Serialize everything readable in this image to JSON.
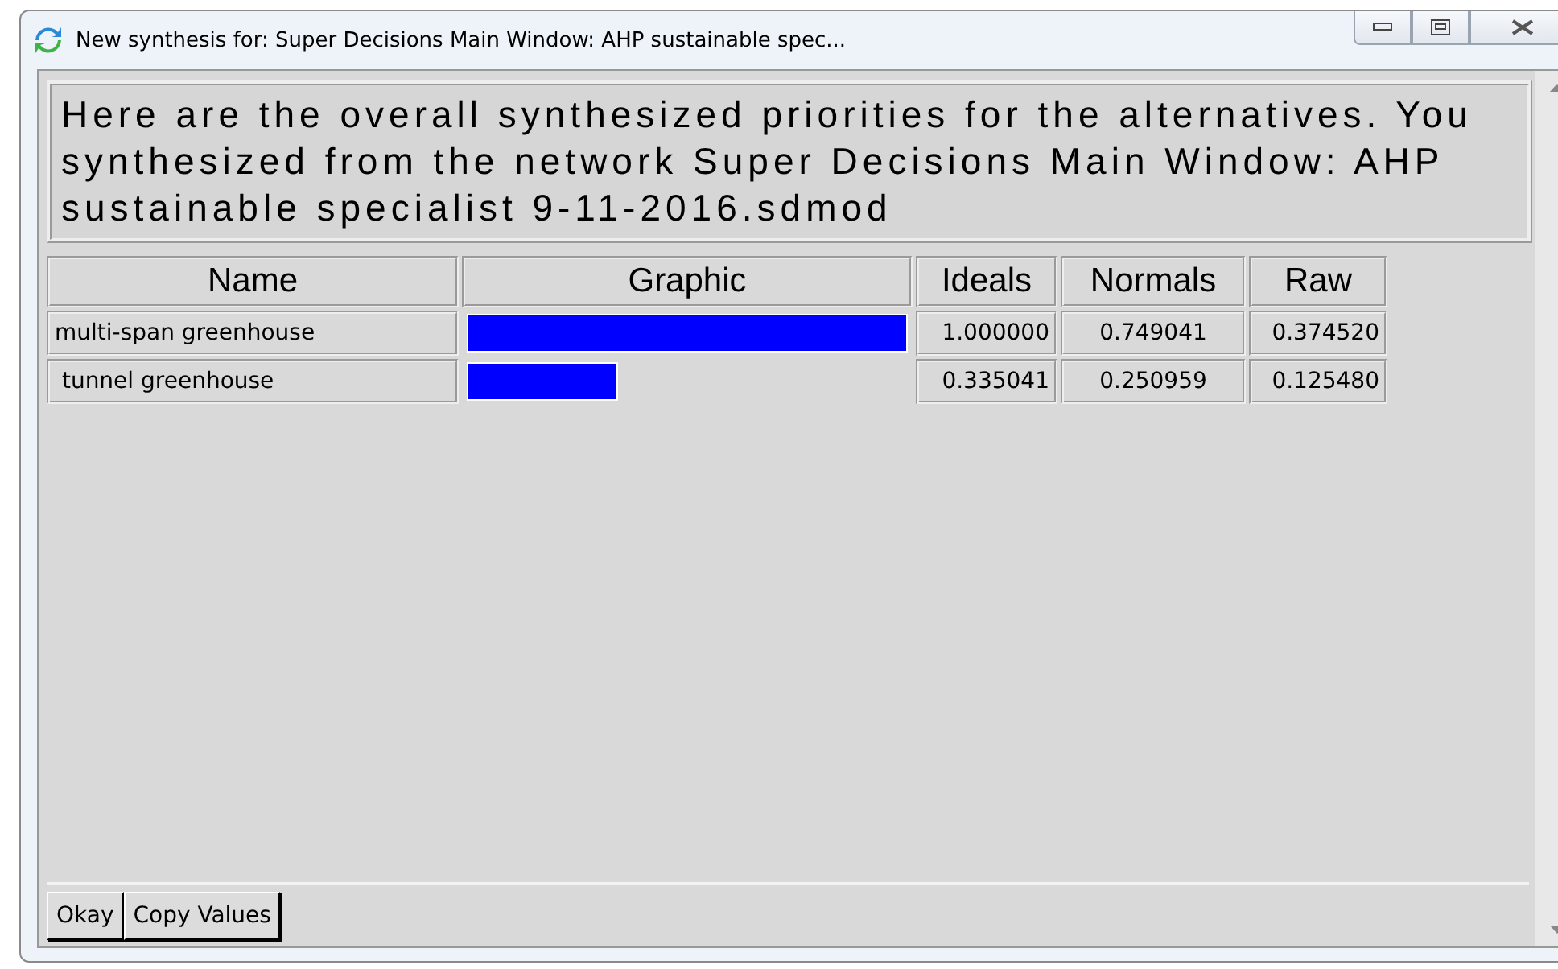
{
  "window": {
    "title": "New synthesis for: Super Decisions Main Window: AHP sustainable spec..."
  },
  "message": "Here are the overall synthesized priorities for the alternatives. You synthesized from the network Super Decisions Main Window: AHP sustainable specialist  9-11-2016.sdmod",
  "table": {
    "columns": [
      "Name",
      "Graphic",
      "Ideals",
      "Normals",
      "Raw"
    ],
    "rows": [
      {
        "name": "multi-span greenhouse",
        "level": 1.0,
        "ideals": "1.000000",
        "normals": "0.749041",
        "raw": "0.374520"
      },
      {
        "name": " tunnel greenhouse",
        "level": 0.335,
        "ideals": "0.335041",
        "normals": "0.250959",
        "raw": "0.125480"
      }
    ]
  },
  "buttons": [
    "Okay",
    "Copy Values"
  ]
}
